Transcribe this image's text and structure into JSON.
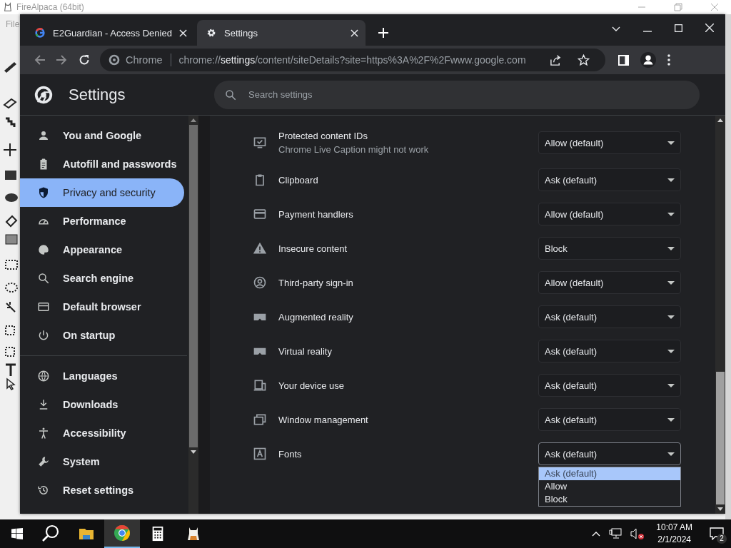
{
  "background_window": {
    "title": "FireAlpaca (64bit)",
    "menu_item": "File"
  },
  "browser": {
    "tabs": [
      {
        "title": "E2Guardian - Access Denied",
        "selected": false
      },
      {
        "title": "Settings",
        "selected": true
      }
    ],
    "address_bar": {
      "chip": "Chrome",
      "url_scheme": "chrome://",
      "url_host": "settings",
      "url_path": "/content/siteDetails?site=https%3A%2F%2Fwww.google.com"
    }
  },
  "settings": {
    "title": "Settings",
    "search": {
      "placeholder": "Search settings"
    },
    "sidebar": {
      "sections": [
        {
          "items": [
            {
              "label": "You and Google",
              "selected": false
            },
            {
              "label": "Autofill and passwords",
              "selected": false
            },
            {
              "label": "Privacy and security",
              "selected": true
            },
            {
              "label": "Performance",
              "selected": false
            },
            {
              "label": "Appearance",
              "selected": false
            },
            {
              "label": "Search engine",
              "selected": false
            },
            {
              "label": "Default browser",
              "selected": false
            },
            {
              "label": "On startup",
              "selected": false
            }
          ]
        },
        {
          "items": [
            {
              "label": "Languages",
              "selected": false
            },
            {
              "label": "Downloads",
              "selected": false
            },
            {
              "label": "Accessibility",
              "selected": false
            },
            {
              "label": "System",
              "selected": false
            },
            {
              "label": "Reset settings",
              "selected": false
            }
          ]
        }
      ]
    },
    "permissions": [
      {
        "label": "Protected content IDs",
        "description": "Chrome Live Caption might not work",
        "value": "Allow (default)",
        "open": false
      },
      {
        "label": "Clipboard",
        "value": "Ask (default)",
        "open": false
      },
      {
        "label": "Payment handlers",
        "value": "Allow (default)",
        "open": false
      },
      {
        "label": "Insecure content",
        "value": "Block",
        "open": false
      },
      {
        "label": "Third-party sign-in",
        "value": "Allow (default)",
        "open": false
      },
      {
        "label": "Augmented reality",
        "value": "Ask (default)",
        "open": false
      },
      {
        "label": "Virtual reality",
        "value": "Ask (default)",
        "open": false
      },
      {
        "label": "Your device use",
        "value": "Ask (default)",
        "open": false
      },
      {
        "label": "Window management",
        "value": "Ask (default)",
        "open": false
      },
      {
        "label": "Fonts",
        "value": "Ask (default)",
        "open": true,
        "options": [
          {
            "label": "Ask (default)",
            "selected": true
          },
          {
            "label": "Allow",
            "selected": false
          },
          {
            "label": "Block",
            "selected": false
          }
        ]
      }
    ]
  },
  "taskbar": {
    "apps": [
      {
        "selected": false
      },
      {
        "selected": true
      },
      {
        "selected": false
      },
      {
        "selected": false
      }
    ],
    "time": "10:07 AM",
    "date": "2/1/2024",
    "notifications": "2"
  }
}
